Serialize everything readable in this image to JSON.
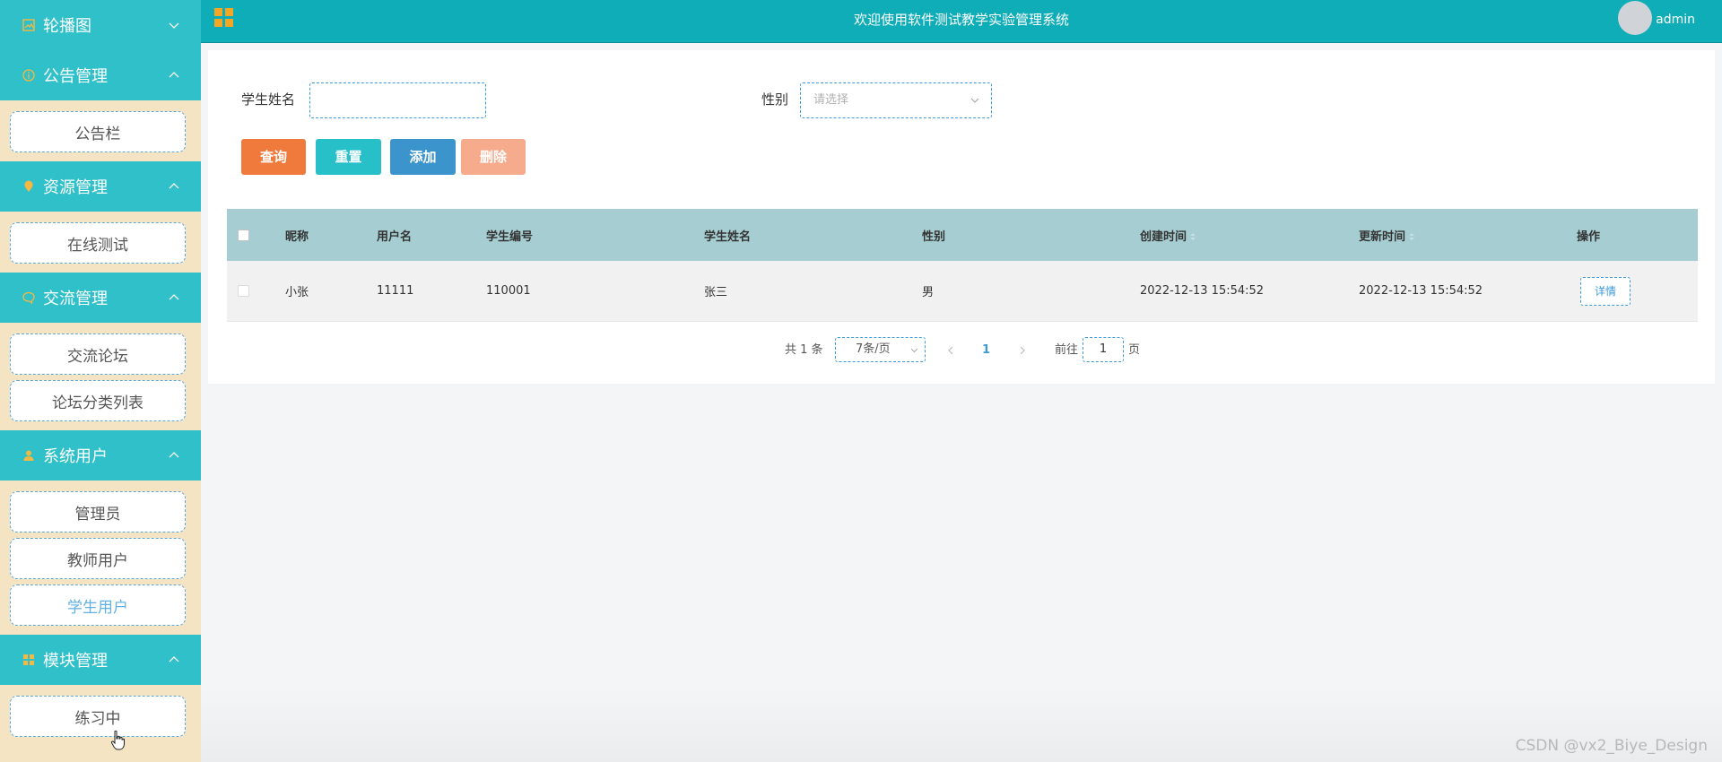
{
  "sidebar": {
    "sections": [
      {
        "label": "轮播图",
        "icon": "image-icon",
        "items": []
      },
      {
        "label": "公告管理",
        "icon": "info-icon",
        "items": [
          "公告栏"
        ]
      },
      {
        "label": "资源管理",
        "icon": "location-pin-icon",
        "items": [
          "在线测试"
        ]
      },
      {
        "label": "交流管理",
        "icon": "chat-bubble-icon",
        "items": [
          "交流论坛",
          "论坛分类列表"
        ]
      },
      {
        "label": "系统用户",
        "icon": "user-icon",
        "items": [
          "管理员",
          "教师用户",
          "学生用户"
        ]
      },
      {
        "label": "模块管理",
        "icon": "grid-icon",
        "items": [
          "练习中"
        ]
      }
    ],
    "active_item": "学生用户"
  },
  "header": {
    "title": "欢迎使用软件测试教学实验管理系统",
    "username": "admin"
  },
  "search": {
    "name_label": "学生姓名",
    "name_value": "",
    "gender_label": "性别",
    "gender_placeholder": "请选择"
  },
  "buttons": {
    "query": "查询",
    "reset": "重置",
    "add": "添加",
    "delete": "删除"
  },
  "table": {
    "columns": [
      "昵称",
      "用户名",
      "学生编号",
      "学生姓名",
      "性别",
      "创建时间",
      "更新时间",
      "操作"
    ],
    "rows": [
      {
        "nickname": "小张",
        "username": "11111",
        "student_no": "110001",
        "student_name": "张三",
        "gender": "男",
        "created": "2022-12-13 15:54:52",
        "updated": "2022-12-13 15:54:52",
        "action": "详情"
      }
    ]
  },
  "pagination": {
    "total_text": "共 1 条",
    "page_size": "7条/页",
    "current_page": "1",
    "goto_label": "前往",
    "goto_value": "1",
    "page_suffix": "页"
  },
  "watermark": "CSDN @vx2_Biye_Design",
  "colors": {
    "sidebar_head": "#2fc0c9",
    "sidebar_bg": "#f5e4c3",
    "topbar": "#0fadb7",
    "query": "#ef7a3c",
    "reset": "#27c0c8",
    "add": "#3b94cc",
    "delete": "#f5ab8c",
    "table_head": "#a6ced2"
  }
}
